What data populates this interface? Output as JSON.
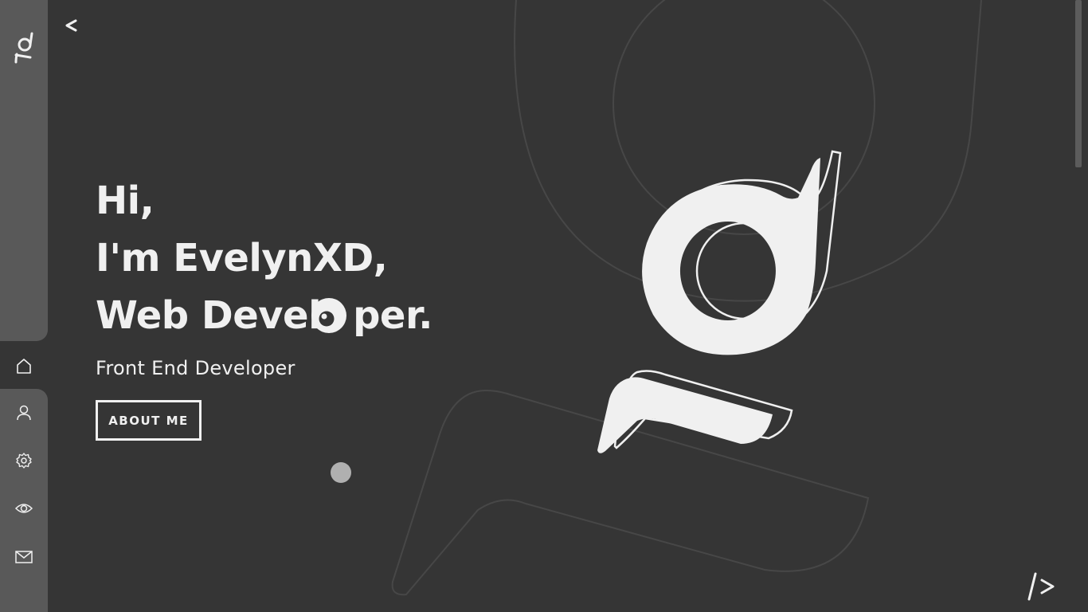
{
  "sidebar": {
    "logo_icon": "brand-logo-icon",
    "items": [
      {
        "name": "home",
        "icon": "home-icon",
        "active": true
      },
      {
        "name": "about",
        "icon": "user-icon",
        "active": false
      },
      {
        "name": "skills",
        "icon": "gear-icon",
        "active": false
      },
      {
        "name": "portfolio",
        "icon": "eye-icon",
        "active": false
      },
      {
        "name": "contact",
        "icon": "mail-icon",
        "active": false
      }
    ]
  },
  "header": {
    "back_label": "<"
  },
  "hero": {
    "line1": "Hi,",
    "line2": "I'm EvelynXD,",
    "line3": "Web Devel",
    "line3_rest": "per.",
    "subtitle": "Front End Developer",
    "cta_label": "ABOUT ME"
  },
  "footer": {
    "code_icon_label": "/>"
  },
  "colors": {
    "background": "#353535",
    "sidebar": "#595959",
    "text": "#f0f0f0",
    "outline": "#474747"
  }
}
